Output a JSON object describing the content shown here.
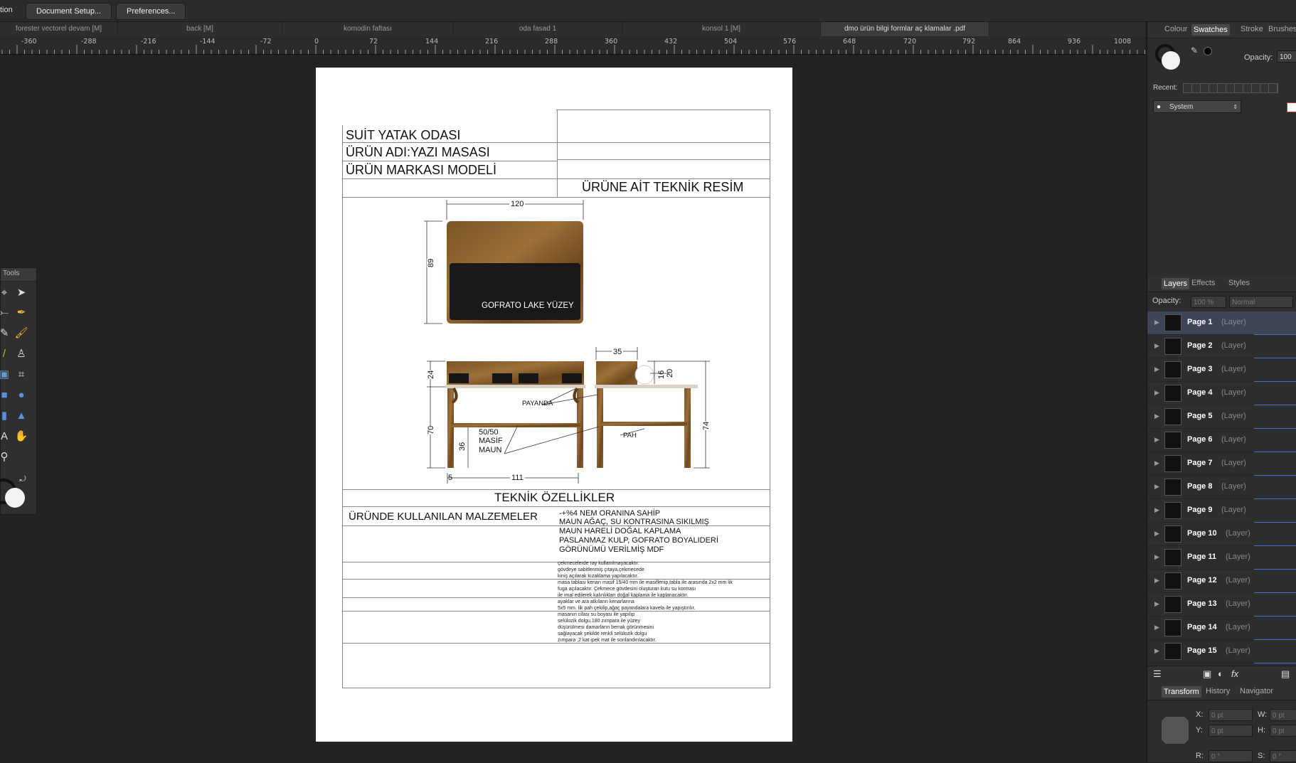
{
  "menu": {
    "cut_label": "tion",
    "document_setup": "Document Setup...",
    "preferences": "Preferences..."
  },
  "tabs": [
    "forester vectorel devam [M]",
    "back  [M]",
    "komodin faftası",
    "oda fasad 1",
    "konsol 1 [M]",
    "dmo ürün bilgi formlar  aç klamalar .pdf"
  ],
  "ruler_labels": [
    "-360",
    "-288",
    "-216",
    "-144",
    "-72",
    "0",
    "72",
    "144",
    "216",
    "288",
    "360",
    "432",
    "504",
    "576",
    "648",
    "720",
    "792",
    "864",
    "936",
    "1008"
  ],
  "tools_panel": {
    "title": "Tools"
  },
  "document": {
    "header_title": "SUİT YATAK ODASI",
    "product_name": "ÜRÜN ADI:YAZI MASASI",
    "product_brand": "ÜRÜN MARKASI MODELİ",
    "technical_drawing": "ÜRÜNE AİT TEKNİK RESİM",
    "drawing": {
      "dim_120": "120",
      "dim_89": "89",
      "surface_label": "GOFRATO LAKE YÜZEY",
      "dim_35": "35",
      "dim_24": "24",
      "dim_16": "16",
      "dim_20": "20",
      "payanda": "PAYANDA",
      "dim_70": "70",
      "dim_74": "74",
      "masif_1": "50/50",
      "masif_2": "MASİF",
      "masif_3": "MAUN",
      "dim_36": "36",
      "pah": "PAH",
      "dim_5": "5",
      "dim_111": "111"
    },
    "specs_title": "TEKNİK ÖZELLİKLER",
    "materials_label": "ÜRÜNDE KULLANILAN MALZEMELER",
    "materials": [
      "-+%4  NEM ORANINA SAHİP",
      "MAUN AĞAÇ, SU KONTRASINA SIKILMIŞ",
      "MAUN  HARELİ DOĞAL KAPLAMA",
      "PASLANMAZ KULP, GOFRATO BOYALIDERİ",
      "GÖRÜNÜMÜ VERİLMİŞ MDF"
    ],
    "notes": [
      "çekmecelerde ray kullanılmayacaktır.",
      "gövdeye sabitlenmiş çıtaya,çekmecede",
      "kiniş açılarak kızaklama yapılacaktır.",
      "masa tablası kenarı masif 15/40 mm ile masiflenip,tabla ile arasında 2x2 mm lik",
      "fuga açılacaktır. Çekmece gövdesini oluşturan kutu su kontrası",
      "ile imal edilerek kalınlıkları doğal kaplama ile kaplanacaktır.",
      "ayaklar ve ara atkıların kenarlarına",
      "5x5 mm. lik pah çekilip,ağaç payandalara kavela ile yapıştırılır.",
      "masanın cilası su boyası ile yapılıp",
      "selülozik dolgu,180 zımpara ile yüzey",
      "düşürülmesi damarların berrak görünmesini",
      "sağlayacak şekilde renkli selülozik dolgu",
      "zımpara ,2 kat ipek mat ile sonlandırılacaktır."
    ]
  },
  "right_panel": {
    "color_tabs": [
      "Colour",
      "Swatches",
      "Stroke",
      "Brushes"
    ],
    "opacity_label": "Opacity:",
    "opacity_value": "100",
    "recent_label": "Recent:",
    "palette": "System",
    "layer_tabs": [
      "Layers",
      "Effects",
      "Styles"
    ],
    "layer_opacity_label": "Opacity:",
    "layer_opacity_value": "100 %",
    "blend_mode": "Normal",
    "layers": [
      {
        "name": "Page 1",
        "type": "(Layer)"
      },
      {
        "name": "Page 2",
        "type": "(Layer)"
      },
      {
        "name": "Page 3",
        "type": "(Layer)"
      },
      {
        "name": "Page 4",
        "type": "(Layer)"
      },
      {
        "name": "Page 5",
        "type": "(Layer)"
      },
      {
        "name": "Page 6",
        "type": "(Layer)"
      },
      {
        "name": "Page 7",
        "type": "(Layer)"
      },
      {
        "name": "Page 8",
        "type": "(Layer)"
      },
      {
        "name": "Page 9",
        "type": "(Layer)"
      },
      {
        "name": "Page 10",
        "type": "(Layer)"
      },
      {
        "name": "Page 11",
        "type": "(Layer)"
      },
      {
        "name": "Page 12",
        "type": "(Layer)"
      },
      {
        "name": "Page 13",
        "type": "(Layer)"
      },
      {
        "name": "Page 14",
        "type": "(Layer)"
      },
      {
        "name": "Page 15",
        "type": "(Layer)"
      }
    ],
    "transform_tabs": [
      "Transform",
      "History",
      "Navigator"
    ],
    "transform": {
      "x_label": "X:",
      "y_label": "Y:",
      "w_label": "W:",
      "h_label": "H:",
      "r_label": "R:",
      "s_label": "S:",
      "x": "0 pt",
      "y": "0 pt",
      "w": "0 pt",
      "h": "0 pt",
      "r": "0 °",
      "s": "0 °"
    },
    "colors": {
      "accent_selected_row": "#3d4557",
      "layer_underline": "#4a6fd0"
    }
  }
}
